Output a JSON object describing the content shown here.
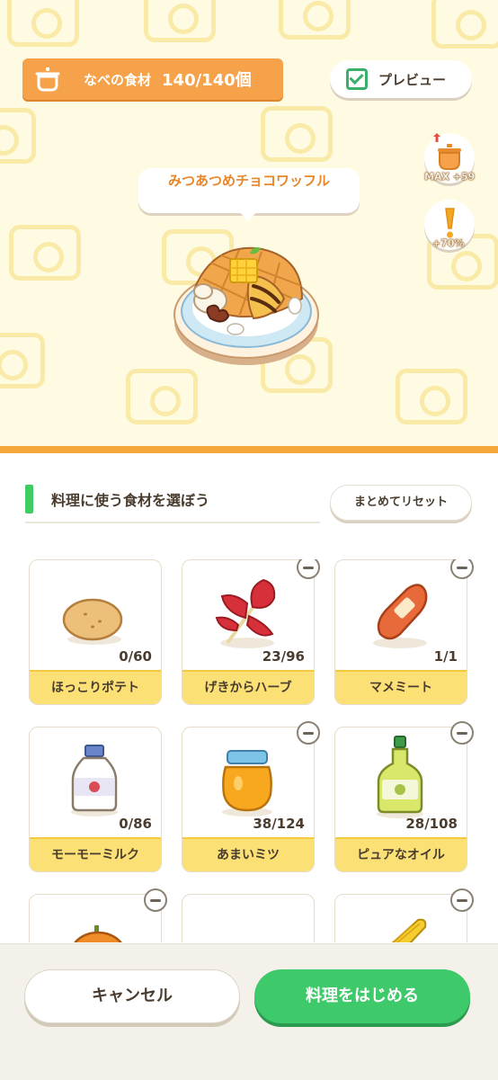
{
  "pot": {
    "label": "なべの食材",
    "count": "140/140個"
  },
  "preview": {
    "label": "プレビュー",
    "checked": true
  },
  "side_buttons": [
    {
      "icon": "pot-capacity-icon",
      "label": "MAX +59"
    },
    {
      "icon": "exclamation-icon",
      "label": "+70%"
    }
  ],
  "dish": {
    "name": "みつあつめチョコワッフル"
  },
  "section": {
    "title": "料理に使う食材を選ぼう",
    "reset_label": "まとめてリセット"
  },
  "ingredients": [
    {
      "name": "ほっこりポテト",
      "count": "0/60",
      "icon": "potato-icon",
      "removable": false
    },
    {
      "name": "げきからハーブ",
      "count": "23/96",
      "icon": "herb-icon",
      "removable": true
    },
    {
      "name": "マメミート",
      "count": "1/1",
      "icon": "sausage-icon",
      "removable": true
    },
    {
      "name": "モーモーミルク",
      "count": "0/86",
      "icon": "milk-icon",
      "removable": false
    },
    {
      "name": "あまいミツ",
      "count": "38/124",
      "icon": "honey-icon",
      "removable": true
    },
    {
      "name": "ピュアなオイル",
      "count": "28/108",
      "icon": "oil-icon",
      "removable": true
    }
  ],
  "partial_row": [
    {
      "icon": "pumpkin-icon",
      "removable": true
    },
    {
      "icon": "egg-icon",
      "removable": false
    },
    {
      "icon": "corn-icon",
      "removable": true
    }
  ],
  "actions": {
    "cancel_label": "キャンセル",
    "start_label": "料理をはじめる"
  },
  "colors": {
    "accent_orange": "#f6a24a",
    "green": "#3ec96a",
    "card_label_bg": "#fbe076"
  }
}
